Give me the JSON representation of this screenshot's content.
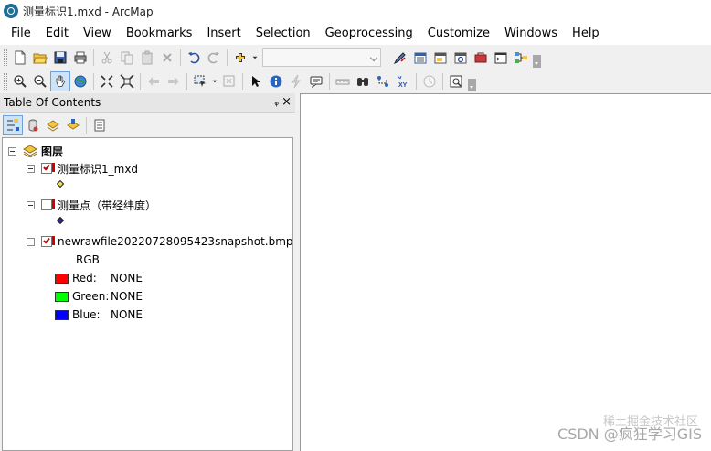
{
  "window": {
    "title": "测量标识1.mxd - ArcMap"
  },
  "menu": [
    "File",
    "Edit",
    "View",
    "Bookmarks",
    "Insert",
    "Selection",
    "Geoprocessing",
    "Customize",
    "Windows",
    "Help"
  ],
  "toolbar1": {
    "scale_dropdown_value": "",
    "icons": [
      "new-document-icon",
      "open-folder-icon",
      "save-icon",
      "print-icon",
      "cut-icon",
      "copy-icon",
      "paste-icon",
      "delete-icon",
      "undo-icon",
      "redo-icon",
      "add-data-icon",
      "editor-icon",
      "table-of-contents-icon",
      "catalog-icon",
      "search-icon",
      "arctoolbox-icon",
      "python-icon",
      "model-builder-icon"
    ]
  },
  "toolbar2": {
    "icons": [
      "zoom-in-icon",
      "zoom-out-icon",
      "pan-icon",
      "full-extent-icon",
      "fixed-zoom-in-icon",
      "fixed-zoom-out-icon",
      "back-extent-icon",
      "forward-extent-icon",
      "select-features-icon",
      "clear-selection-icon",
      "select-elements-icon",
      "identify-icon",
      "hyperlink-icon",
      "html-popup-icon",
      "measure-icon",
      "find-icon",
      "find-route-icon",
      "go-to-xy-icon",
      "time-slider-icon",
      "create-viewer-window-icon"
    ]
  },
  "toc": {
    "title": "Table Of Contents",
    "pin": "ᵩ",
    "close": "×",
    "root_label": "图层",
    "layers": [
      {
        "name": "测量标识1_mxd",
        "checked": true,
        "symbol_color": "#f2e24a"
      },
      {
        "name": "测量点（带经纬度）",
        "checked": false,
        "symbol_color": "#3b1f8a"
      },
      {
        "name": "newrawfile20220728095423snapshot.bmp",
        "checked": true
      }
    ],
    "raster": {
      "rgb_label": "RGB",
      "bands": [
        {
          "label": "Red:",
          "value": "NONE",
          "color": "#ff0000"
        },
        {
          "label": "Green:",
          "value": "NONE",
          "color": "#00ff00"
        },
        {
          "label": "Blue:",
          "value": "NONE",
          "color": "#0000ff"
        }
      ]
    }
  },
  "watermark": {
    "line1": "稀土掘金技术社区",
    "line2": "CSDN @疯狂学习GIS"
  }
}
